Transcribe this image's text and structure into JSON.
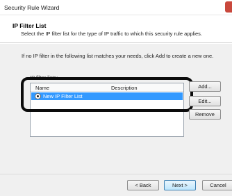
{
  "window": {
    "title": "Security Rule Wizard"
  },
  "header": {
    "title": "IP Filter List",
    "subtitle": "Select the IP filter list for the type of IP traffic to which this security rule applies."
  },
  "content": {
    "instruction": "If no IP filter in the following list matches your needs, click Add to create a new one.",
    "group_label": "IP filter lists:",
    "list": {
      "columns": [
        "Name",
        "Description"
      ],
      "rows": [
        {
          "name": "New IP Filter List",
          "description": "",
          "selected": true
        }
      ]
    },
    "buttons": {
      "add": "Add...",
      "edit": "Edit...",
      "remove": "Remove"
    }
  },
  "footer": {
    "back": "< Back",
    "next": "Next >",
    "cancel": "Cancel"
  },
  "colors": {
    "selection": "#3399ff",
    "content_bg": "#f0f0f0",
    "highlight_outline": "#0c0c0c",
    "close": "#c9483c"
  }
}
